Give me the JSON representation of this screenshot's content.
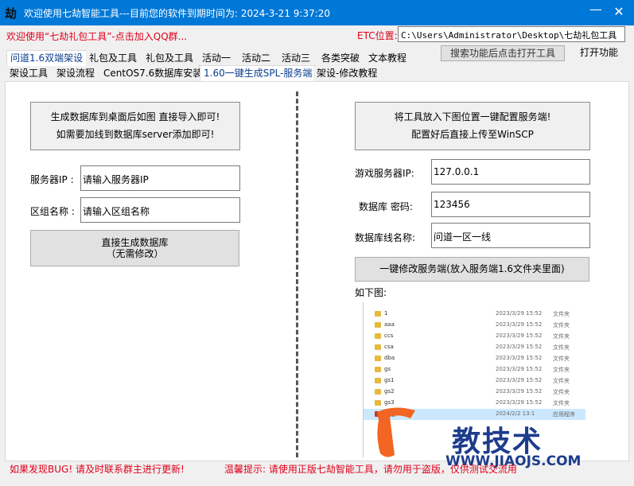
{
  "window": {
    "logo_text": "劫",
    "title": "欢迎使用七劫智能工具---目前您的软件到期时间为: 2024-3-21 9:37:20",
    "minimize": "—",
    "close": "✕"
  },
  "header": {
    "welcome": "欢迎使用“七劫礼包工具”-点击加入QQ群...",
    "etc_label": "ETC位置:",
    "etc_path": "C:\\Users\\Administrator\\Desktop\\七劫礼包工具",
    "search_button": "搜索功能后点击打开工具",
    "open_button": "打开功能"
  },
  "tabs_row1": [
    {
      "label": "问道1.6双端架设"
    },
    {
      "label": "礼包及工具"
    },
    {
      "label": "礼包及工具"
    },
    {
      "label": "活动一"
    },
    {
      "label": "活动二"
    },
    {
      "label": "活动三"
    },
    {
      "label": "各类突破"
    },
    {
      "label": "文本教程"
    }
  ],
  "tabs_row2": [
    {
      "label": "架设工具"
    },
    {
      "label": "架设流程"
    },
    {
      "label": "CentOS7.6数据库安装"
    },
    {
      "label": "1.60一键生成SPL-服务端"
    },
    {
      "label": "架设-修改教程"
    }
  ],
  "left": {
    "info_line1": "生成数据库到桌面后如图 直接导入即可!",
    "info_line2": "如需要加线到数据库server添加即可!",
    "server_ip_label": "服务器IP :",
    "server_ip_value": "请输入服务器IP",
    "zone_label": "区组名称 :",
    "zone_value": "请输入区组名称",
    "gen_button_line1": "直接生成数据库",
    "gen_button_line2": "（无需修改）"
  },
  "right": {
    "info_line1": "将工具放入下图位置一键配置服务端!",
    "info_line2": "配置好后直接上传至WinSCP",
    "game_ip_label": "游戏服务器IP:",
    "game_ip_value": "127.0.0.1",
    "db_pwd_label": "数据库 密码:",
    "db_pwd_value": "123456",
    "db_line_label": "数据库线名称:",
    "db_line_value": "问道一区一线",
    "modify_button": "一键修改服务端(放入服务端1.6文件夹里面)",
    "below_label": "如下图:"
  },
  "preview_files": [
    {
      "name": "1",
      "date": "2023/3/29 15:52",
      "type": "文件夹"
    },
    {
      "name": "aaa",
      "date": "2023/3/29 15:52",
      "type": "文件夹"
    },
    {
      "name": "ccs",
      "date": "2023/3/29 15:52",
      "type": "文件夹"
    },
    {
      "name": "csa",
      "date": "2023/3/29 15:52",
      "type": "文件夹"
    },
    {
      "name": "dba",
      "date": "2023/3/29 15:52",
      "type": "文件夹"
    },
    {
      "name": "gs",
      "date": "2023/3/29 15:52",
      "type": "文件夹"
    },
    {
      "name": "gs1",
      "date": "2023/3/29 15:52",
      "type": "文件夹"
    },
    {
      "name": "gs2",
      "date": "2023/3/29 15:52",
      "type": "文件夹"
    },
    {
      "name": "gs3",
      "date": "2023/3/29 15:52",
      "type": "文件夹"
    },
    {
      "name": "七劫",
      "date": "2024/2/2 13:1",
      "type": "应用程序"
    }
  ],
  "watermark": {
    "text": "教技术",
    "url": "WWW.JIAOJS.COM",
    "colors": {
      "orange": "#f26522",
      "blue": "#1d3c8c"
    }
  },
  "footer": {
    "left": "如果发现BUG! 请及时联系群主进行更新!",
    "right": "温馨提示: 请使用正版七劫智能工具，请勿用于盗版，仅供测试交流用"
  },
  "colors": {
    "titlebar": "#0078d7",
    "alert_red": "#e0001b",
    "selected_tab_text": "#0a3d8f"
  }
}
